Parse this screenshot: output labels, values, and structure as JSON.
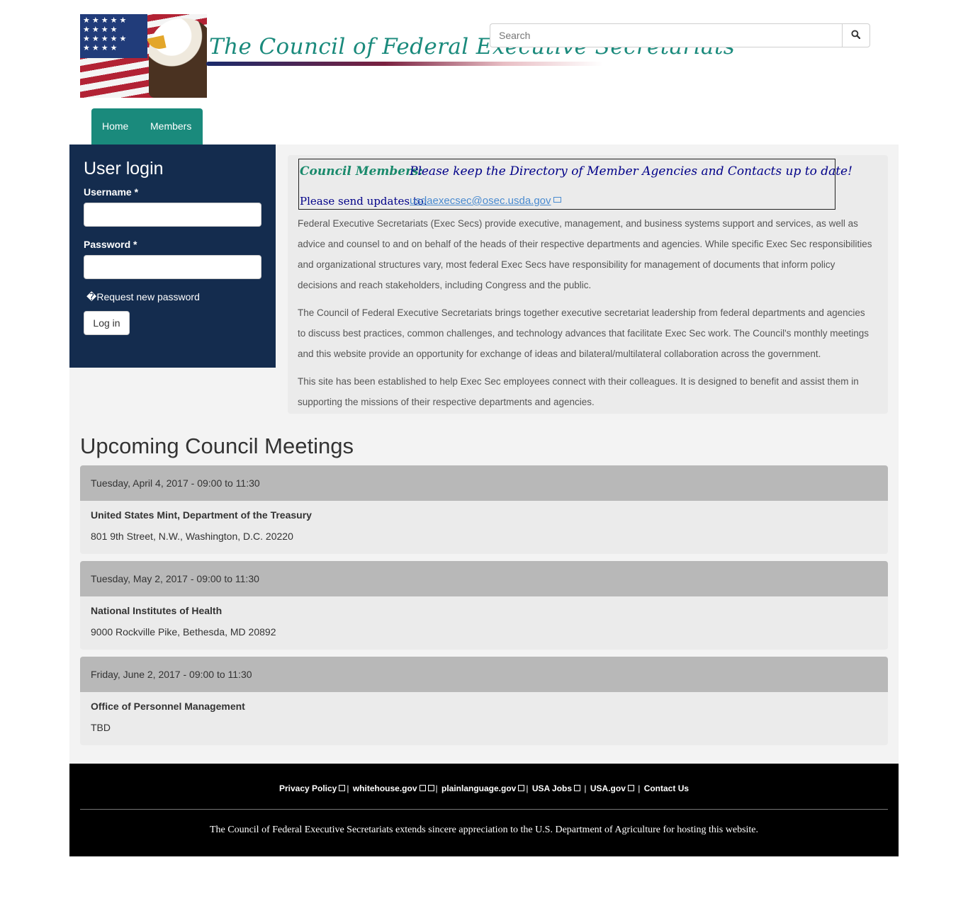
{
  "header": {
    "site_name": "The Council of Federal Executive Secretariats",
    "logo_icon": "flag-eagle-logo",
    "search": {
      "placeholder": "Search",
      "icon": "search-icon"
    }
  },
  "nav": {
    "items": [
      {
        "label": "Home"
      },
      {
        "label": "Members"
      }
    ]
  },
  "login": {
    "title": "User login",
    "username_label": "Username *",
    "password_label": "Password *",
    "request_link": "�Request new password",
    "button": "Log in"
  },
  "notice": {
    "lead": "Council Members:",
    "message": "Please keep the Directory of Member Agencies and Contacts up to date!",
    "send_label": "Please send updates to:",
    "email": "usdaexecsec@osec.usda.gov"
  },
  "intro": {
    "paragraphs": [
      "Federal Executive Secretariats (Exec Secs) provide executive, management, and business systems support and services, as well as advice and counsel to and on behalf of the heads of their respective departments and agencies.  While specific Exec Sec responsibilities and organizational structures vary, most federal Exec Secs have responsibility for management of documents that inform policy decisions and reach stakeholders, including Congress and the public.",
      "The Council of Federal Executive Secretariats brings together executive secretariat leadership from federal departments and agencies to discuss best practices, common challenges, and technology advances that facilitate Exec Sec work.  The Council's monthly meetings and this website provide an opportunity for exchange of ideas and bilateral/multilateral collaboration across the government.",
      "This site has been established to help Exec Sec employees connect with their colleagues.  It is designed to benefit and assist them in supporting the missions of their respective departments and agencies."
    ]
  },
  "meetings": {
    "title": "Upcoming Council Meetings",
    "items": [
      {
        "date": "Tuesday, April 4, 2017 - 09:00 to 11:30",
        "place": "United States Mint, Department of the Treasury",
        "address": "801 9th Street, N.W., Washington, D.C. 20220"
      },
      {
        "date": "Tuesday, May 2, 2017 - 09:00 to 11:30",
        "place": "National Institutes of Health",
        "address": "9000 Rockville Pike, Bethesda, MD 20892"
      },
      {
        "date": "Friday, June 2, 2017 - 09:00 to 11:30",
        "place": "Office of Personnel Management",
        "address": "TBD"
      }
    ]
  },
  "footer": {
    "links": [
      "Privacy Policy",
      "whitehouse.gov",
      "plainlanguage.gov",
      "USA Jobs",
      "USA.gov",
      "Contact Us"
    ],
    "separator": "|",
    "thanks": "The Council of Federal Executive Secretariats extends sincere appreciation to the U.S. Department of Agriculture for hosting this website."
  },
  "colors": {
    "brand_teal": "#1a8a7c",
    "login_navy": "#142c4e",
    "link_blue": "#4a8bd0",
    "footer_bg": "#000000"
  }
}
